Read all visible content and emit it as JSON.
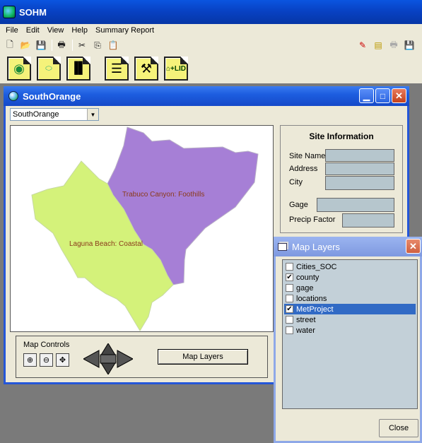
{
  "app": {
    "title": "SOHM"
  },
  "menu": [
    "File",
    "Edit",
    "View",
    "Help",
    "Summary Report"
  ],
  "child_window": {
    "title": "SouthOrange",
    "region_select": "SouthOrange",
    "map": {
      "regions": [
        {
          "label": "Trabuco Canyon: Foothills",
          "color": "#a67fd6"
        },
        {
          "label": "Laguna Beach: Coastal",
          "color": "#d4f27a"
        }
      ]
    },
    "site_info": {
      "heading": "Site Information",
      "fields": {
        "site_name": "Site Name",
        "address": "Address",
        "city": "City",
        "gage": "Gage",
        "precip_factor": "Precip Factor"
      }
    },
    "map_controls": {
      "legend": "Map Controls",
      "map_layers_button": "Map Layers"
    }
  },
  "layers_window": {
    "title": "Map Layers",
    "layers": [
      {
        "name": "Cities_SOC",
        "checked": false
      },
      {
        "name": "county",
        "checked": true
      },
      {
        "name": "gage",
        "checked": false
      },
      {
        "name": "locations",
        "checked": false
      },
      {
        "name": "MetProject",
        "checked": true,
        "selected": true
      },
      {
        "name": "street",
        "checked": false
      },
      {
        "name": "water",
        "checked": false
      }
    ],
    "close_label": "Close"
  }
}
